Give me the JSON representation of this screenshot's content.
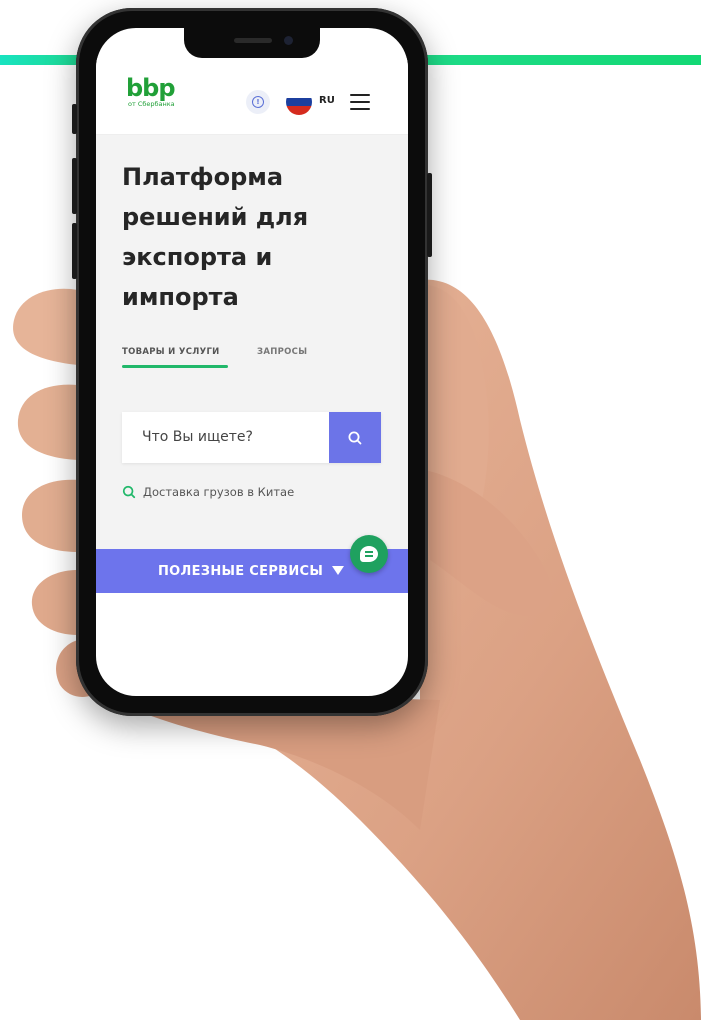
{
  "brand": {
    "logo_text": "bbp",
    "logo_subtitle": "от Сбербанка",
    "color": "#21a038"
  },
  "header": {
    "language": "RU",
    "info_icon": "info-icon",
    "flag_icon": "russia-flag-icon",
    "menu_icon": "hamburger-menu-icon"
  },
  "hero": {
    "title": "Платформа решений для экспорта и импорта"
  },
  "tabs": [
    {
      "label": "ТОВАРЫ И УСЛУГИ",
      "active": true
    },
    {
      "label": "ЗАПРОСЫ",
      "active": false
    }
  ],
  "search": {
    "placeholder": "Что Вы ищете?",
    "value": "",
    "button_icon": "search-icon"
  },
  "hint": {
    "text": "Доставка грузов в Китае",
    "icon": "search-icon"
  },
  "services": {
    "label": "ПОЛЕЗНЫЕ СЕРВИСЫ"
  },
  "colors": {
    "accent": "#6c74e8",
    "tab_underline": "#21b86a",
    "stripe": "#1fdc8a",
    "chat_button": "#1fa15f"
  }
}
